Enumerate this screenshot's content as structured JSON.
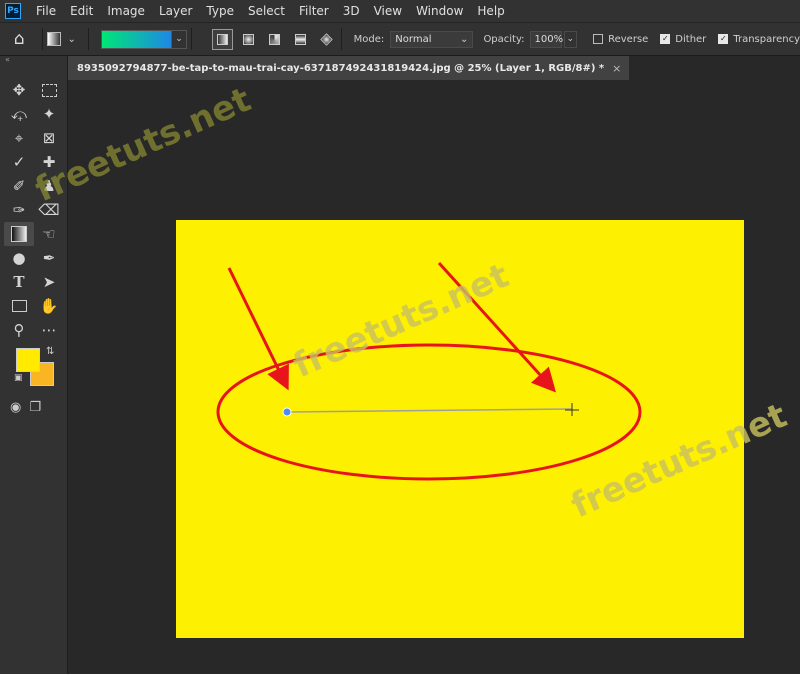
{
  "menubar": {
    "logo": "Ps",
    "items": [
      "File",
      "Edit",
      "Image",
      "Layer",
      "Type",
      "Select",
      "Filter",
      "3D",
      "View",
      "Window",
      "Help"
    ]
  },
  "options": {
    "home_icon": "home-icon",
    "gradient_colors": [
      "#00e676",
      "#1e88e5"
    ],
    "mode_label": "Mode:",
    "mode_value": "Normal",
    "opacity_label": "Opacity:",
    "opacity_value": "100%",
    "reverse_label": "Reverse",
    "reverse_checked": false,
    "dither_label": "Dither",
    "dither_checked": true,
    "transparency_label": "Transparency",
    "transparency_checked": true
  },
  "document": {
    "tab_title": "8935092794877-be-tap-to-mau-trai-cay-637187492431819424.jpg @ 25% (Layer 1, RGB/8#) *",
    "canvas_color": "#fdf000"
  },
  "colors": {
    "foreground": "#ffea00",
    "background": "#f9b522",
    "annotation": "#e8141c"
  },
  "watermarks": [
    "freetuts.net",
    "freetuts.net",
    "freetuts.net"
  ]
}
